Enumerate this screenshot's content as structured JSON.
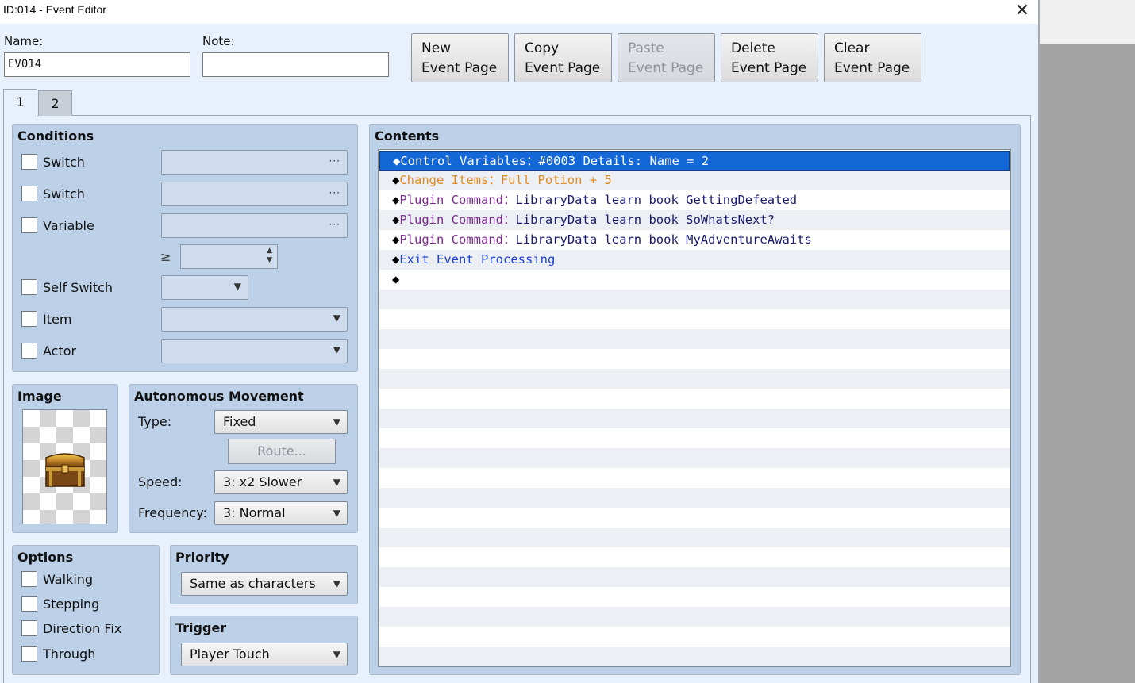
{
  "window": {
    "title": "ID:014 - Event Editor",
    "close_glyph": "✕"
  },
  "name_label": "Name:",
  "name_value": "EV014",
  "note_label": "Note:",
  "note_value": "",
  "toolbar": {
    "new_page": "New\nEvent Page",
    "copy_page": "Copy\nEvent Page",
    "paste_page": "Paste\nEvent Page",
    "delete_page": "Delete\nEvent Page",
    "clear_page": "Clear\nEvent Page"
  },
  "tabs": [
    "1",
    "2"
  ],
  "conditions": {
    "title": "Conditions",
    "switch1": "Switch",
    "switch2": "Switch",
    "variable": "Variable",
    "ge_symbol": "≥",
    "self_switch": "Self Switch",
    "item": "Item",
    "actor": "Actor",
    "dots": "···"
  },
  "image": {
    "title": "Image",
    "icon": "treasure-chest-icon"
  },
  "movement": {
    "title": "Autonomous Movement",
    "type_label": "Type:",
    "type_value": "Fixed",
    "route_label": "Route...",
    "speed_label": "Speed:",
    "speed_value": "3: x2 Slower",
    "frequency_label": "Frequency:",
    "frequency_value": "3: Normal"
  },
  "options": {
    "title": "Options",
    "walking": "Walking",
    "stepping": "Stepping",
    "direction_fix": "Direction Fix",
    "through": "Through"
  },
  "priority": {
    "title": "Priority",
    "value": "Same as characters"
  },
  "trigger": {
    "title": "Trigger",
    "value": "Player Touch"
  },
  "contents": {
    "title": "Contents",
    "commands": [
      {
        "text": "Control Variables：#0003 Details: Name = 2",
        "color": "#ffffff",
        "selected": true
      },
      {
        "text": "Change Items：Full Potion + 5",
        "color": "#e08a1e"
      },
      {
        "cmd": "Plugin Command：",
        "arg": "LibraryData learn book GettingDefeated",
        "color": "#7a2a8c",
        "argcolor": "#1a1a6e"
      },
      {
        "cmd": "Plugin Command：",
        "arg": "LibraryData learn book SoWhatsNext?",
        "color": "#7a2a8c",
        "argcolor": "#1a1a6e"
      },
      {
        "cmd": "Plugin Command：",
        "arg": "LibraryData learn book MyAdventureAwaits",
        "color": "#7a2a8c",
        "argcolor": "#1a1a6e"
      },
      {
        "text": "Exit Event Processing",
        "color": "#1b3fd1"
      },
      {
        "text": "",
        "color": "#000000"
      }
    ],
    "bullet": "◆"
  }
}
